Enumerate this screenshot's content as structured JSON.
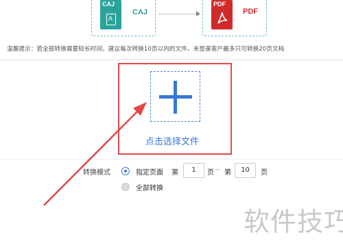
{
  "formats": {
    "source": {
      "tag": "CAJ",
      "icon_letter": "A",
      "label": "CAJ",
      "color": "#2aa39a"
    },
    "target": {
      "tag": "PDF",
      "label": "PDF",
      "color": "#d12a2a"
    }
  },
  "tip": "温馨提示：若全部转换需要较长时间，建议每次转换10页以内的文件。未登录客户最多只可转换20页文档",
  "upload": {
    "label": "点击选择文件"
  },
  "mode": {
    "label": "转换模式",
    "options": [
      "指定页面",
      "全部转换"
    ],
    "selected": "指定页面",
    "page_prefix": "第",
    "page_suffix": "页",
    "separator": "~",
    "from": "1",
    "to": "10"
  },
  "watermark": "软件技巧",
  "colors": {
    "accent": "#3a76d4",
    "highlight": "#e04848"
  }
}
